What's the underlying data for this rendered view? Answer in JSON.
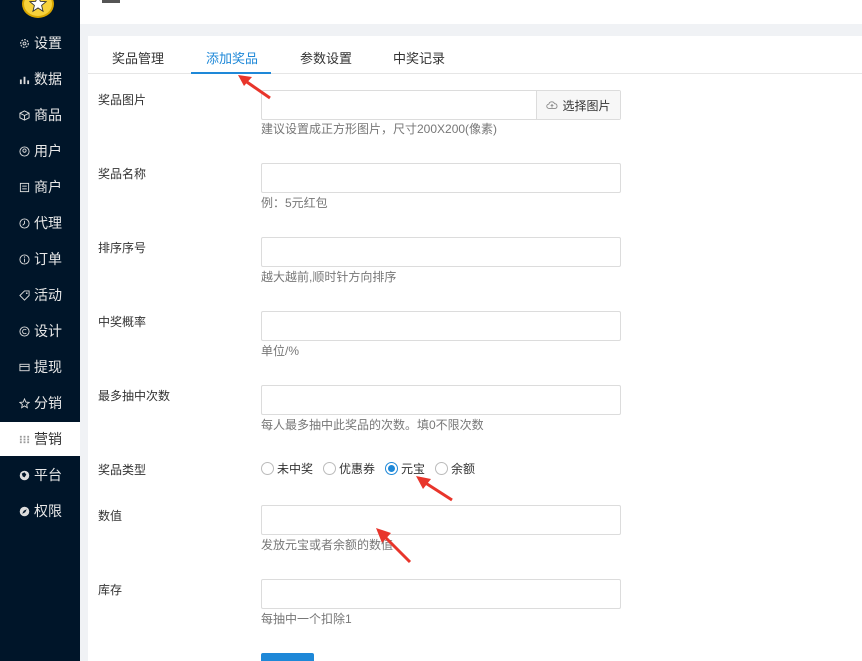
{
  "sidebar": {
    "items": [
      {
        "label": "设置",
        "icon": "gear-icon"
      },
      {
        "label": "数据",
        "icon": "bar-chart-icon"
      },
      {
        "label": "商品",
        "icon": "box-icon"
      },
      {
        "label": "用户",
        "icon": "user-icon"
      },
      {
        "label": "商户",
        "icon": "store-icon"
      },
      {
        "label": "代理",
        "icon": "clock-icon"
      },
      {
        "label": "订单",
        "icon": "info-icon"
      },
      {
        "label": "活动",
        "icon": "tag-icon"
      },
      {
        "label": "设计",
        "icon": "copyright-icon"
      },
      {
        "label": "提现",
        "icon": "card-icon"
      },
      {
        "label": "分销",
        "icon": "star-icon"
      },
      {
        "label": "营销",
        "icon": "grid-icon",
        "active": true
      },
      {
        "label": "平台",
        "icon": "globe-icon"
      },
      {
        "label": "权限",
        "icon": "compass-icon"
      }
    ]
  },
  "tabs": [
    {
      "label": "奖品管理"
    },
    {
      "label": "添加奖品",
      "active": true
    },
    {
      "label": "参数设置"
    },
    {
      "label": "中奖记录"
    }
  ],
  "form": {
    "image": {
      "label": "奖品图片",
      "button": "选择图片",
      "help": "建议设置成正方形图片，尺寸200X200(像素)"
    },
    "name": {
      "label": "奖品名称",
      "help": "例：5元红包"
    },
    "order": {
      "label": "排序序号",
      "help": "越大越前,顺时针方向排序"
    },
    "probability": {
      "label": "中奖概率",
      "help": "单位/%"
    },
    "max_wins": {
      "label": "最多抽中次数",
      "help": "每人最多抽中此奖品的次数。填0不限次数"
    },
    "type": {
      "label": "奖品类型",
      "options": [
        {
          "label": "未中奖",
          "checked": false
        },
        {
          "label": "优惠券",
          "checked": false
        },
        {
          "label": "元宝",
          "checked": true
        },
        {
          "label": "余额",
          "checked": false
        }
      ]
    },
    "value": {
      "label": "数值",
      "help": "发放元宝或者余额的数值"
    },
    "stock": {
      "label": "库存",
      "help": "每抽中一个扣除1"
    }
  },
  "colors": {
    "accent": "#1e88d8",
    "sidebar": "#001529",
    "annotation": "#e8352b"
  }
}
